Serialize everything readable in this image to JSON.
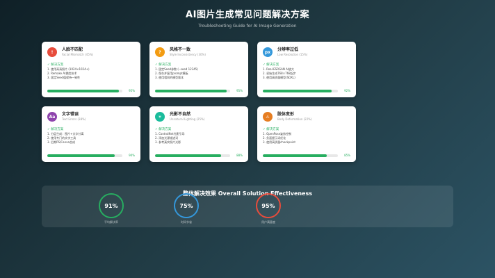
{
  "header": {
    "title": "AI图片生成常见问题解决方案",
    "subtitle": "Troubleshooting Guide for AI Image Generation"
  },
  "cards": [
    {
      "icon": "!",
      "icon_name": "alert-icon",
      "color": "#e74c3c",
      "title": "人脸不匹配",
      "subtitle": "Facial Mismatch (45%)",
      "solution_label": "✓ 解决方案",
      "steps": [
        "1. 使用高清照片 (1024×1024+)",
        "2. Remake AI换脸技术",
        "3. 固定Seed值保持一致性"
      ],
      "percent_label": "95%",
      "progress": 0.95
    },
    {
      "icon": "?",
      "icon_name": "question-icon",
      "color": "#f39c12",
      "title": "风格不一致",
      "subtitle": "Style Inconsistency (30%)",
      "solution_label": "✓ 解决方案",
      "steps": [
        "1. 固定Seed参数 (--seed 12345)",
        "2. 保存并复用prompt模板",
        "3. 使用相同的模型版本"
      ],
      "percent_label": "95%",
      "progress": 0.95
    },
    {
      "icon": "px",
      "icon_name": "pixel-icon",
      "color": "#3498db",
      "title": "分辨率过低",
      "subtitle": "Low Resolution (15%)",
      "solution_label": "✓ 解决方案",
      "steps": [
        "1. Real-ESRGAN AI放大",
        "2. 初始生成768×768起步",
        "3. 使用高质量模型(SDXL)"
      ],
      "percent_label": "92%",
      "progress": 0.92
    },
    {
      "icon": "Aa",
      "icon_name": "text-icon",
      "color": "#8e44ad",
      "title": "文字错误",
      "subtitle": "Text Errors (38%)",
      "solution_label": "✓ 解决方案",
      "steps": [
        "1. 分层生成：图片+文字分离",
        "2. 使用专门的文字工具",
        "3. 后期PS/Canva合成"
      ],
      "percent_label": "90%",
      "progress": 0.9
    },
    {
      "icon": "☀",
      "icon_name": "sun-icon",
      "color": "#1abc9c",
      "title": "光影不自然",
      "subtitle": "Unnatural Lighting (25%)",
      "solution_label": "✓ 解决方案",
      "steps": [
        "1. ControlNet光影引导",
        "2. 添加光源描述词",
        "3. 参考真实照片光影"
      ],
      "percent_label": "88%",
      "progress": 0.88
    },
    {
      "icon": "⚠",
      "icon_name": "warning-icon",
      "color": "#e67e22",
      "title": "肢体变形",
      "subtitle": "Body Deformation (22%)",
      "solution_label": "✓ 解决方案",
      "steps": [
        "1. OpenPose姿势控制",
        "2. 负面提示词优化",
        "3. 使用高质量checkpoint"
      ],
      "percent_label": "85%",
      "progress": 0.85
    }
  ],
  "summary": {
    "title": "整体解决效果 Overall Solution Effectiveness",
    "metrics": [
      {
        "value": "91%",
        "label": "平均解决率",
        "color": "#27ae60"
      },
      {
        "value": "75%",
        "label": "时间节省",
        "color": "#3498db"
      },
      {
        "value": "95%",
        "label": "用户满意度",
        "color": "#e74c3c"
      }
    ]
  }
}
